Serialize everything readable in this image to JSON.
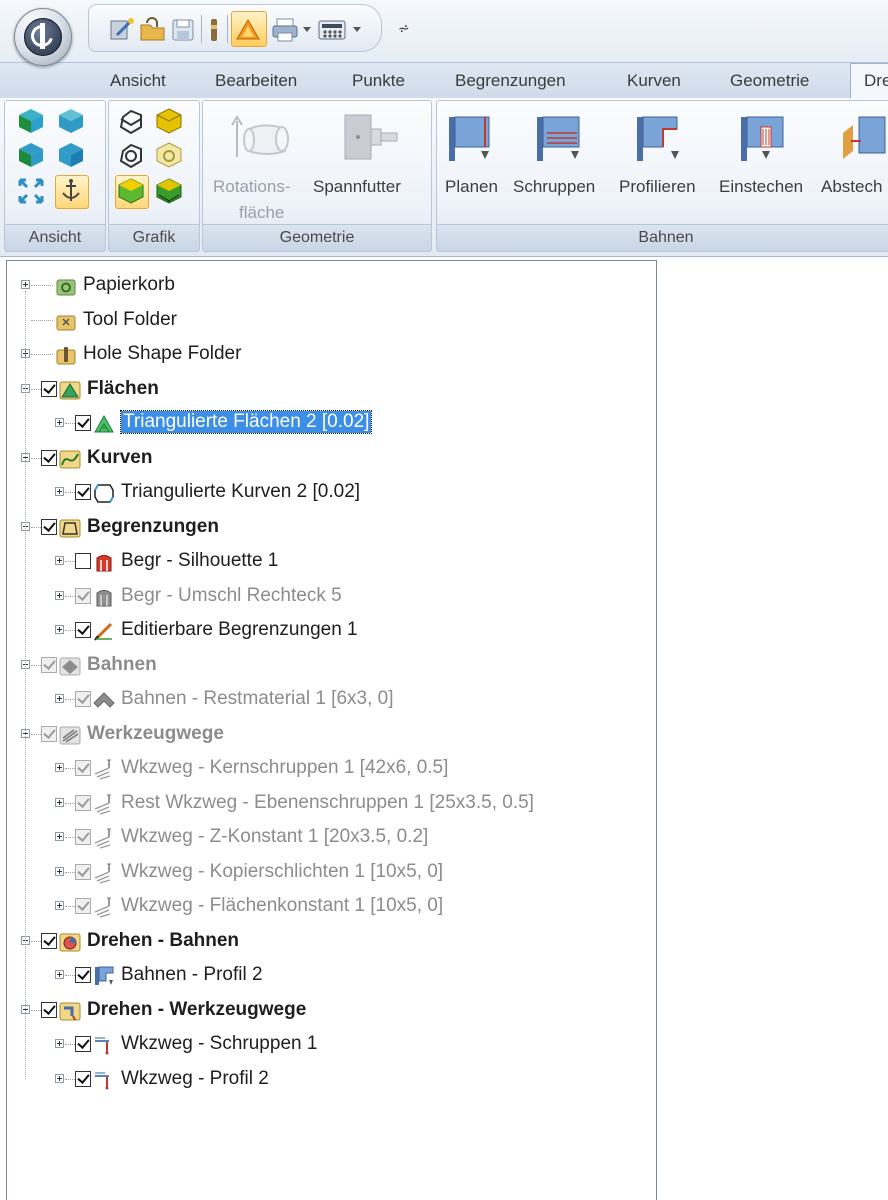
{
  "quick_access": {
    "icons": [
      "wizard-icon",
      "folder-open-icon",
      "save-icon",
      "hole-icon",
      "shading-icon",
      "print-icon",
      "calculator-icon"
    ],
    "customize_glyph": "⩫"
  },
  "tabs": [
    "Ansicht",
    "Bearbeiten",
    "Punkte",
    "Begrenzungen",
    "Kurven",
    "Geometrie",
    "Dre"
  ],
  "ribbon": {
    "groups": {
      "ansicht": "Ansicht",
      "grafik": "Grafik",
      "geometrie": "Geometrie",
      "bahnen": "Bahnen"
    },
    "geometrie_buttons": {
      "rotation_line1": "Rotations-",
      "rotation_line2": "fläche",
      "chuck": "Spannfutter"
    },
    "bahnen_buttons": {
      "planen": "Planen",
      "schruppen": "Schruppen",
      "profilieren": "Profilieren",
      "einstechen": "Einstechen",
      "abstechen": "Abstech"
    }
  },
  "tree": [
    {
      "label": "Papierkorb",
      "icon": "recycle-bin-icon",
      "level": 0,
      "expander": "plus",
      "checkbox": "none",
      "style": "normal"
    },
    {
      "label": "Tool Folder",
      "icon": "tool-folder-icon",
      "level": 0,
      "expander": "none",
      "checkbox": "none",
      "style": "normal"
    },
    {
      "label": "Hole Shape Folder",
      "icon": "hole-folder-icon",
      "level": 0,
      "expander": "plus",
      "checkbox": "none",
      "style": "normal"
    },
    {
      "label": "Flächen",
      "icon": "surfaces-icon",
      "level": 0,
      "expander": "minus",
      "checkbox": "checked",
      "style": "bold"
    },
    {
      "label": "Triangulierte Flächen 2 [0.02]",
      "icon": "triangulated-surface-icon",
      "level": 1,
      "expander": "plus",
      "checkbox": "checked",
      "style": "selected"
    },
    {
      "label": "Kurven",
      "icon": "curves-icon",
      "level": 0,
      "expander": "minus",
      "checkbox": "checked",
      "style": "bold"
    },
    {
      "label": "Triangulierte Kurven 2 [0.02]",
      "icon": "triangulated-curve-icon",
      "level": 1,
      "expander": "plus",
      "checkbox": "checked",
      "style": "normal"
    },
    {
      "label": "Begrenzungen",
      "icon": "boundaries-icon",
      "level": 0,
      "expander": "minus",
      "checkbox": "checked",
      "style": "bold"
    },
    {
      "label": "Begr - Silhouette 1",
      "icon": "silhouette-boundary-icon",
      "level": 1,
      "expander": "plus",
      "checkbox": "unchecked",
      "style": "normal"
    },
    {
      "label": "Begr - Umschl Rechteck 5",
      "icon": "rectangle-boundary-icon",
      "level": 1,
      "expander": "plus",
      "checkbox": "gray-checked",
      "style": "gray"
    },
    {
      "label": "Editierbare Begrenzungen 1",
      "icon": "editable-boundary-icon",
      "level": 1,
      "expander": "plus",
      "checkbox": "checked",
      "style": "normal"
    },
    {
      "label": "Bahnen",
      "icon": "patterns-icon",
      "level": 0,
      "expander": "minus",
      "checkbox": "gray-checked",
      "style": "bold-gray"
    },
    {
      "label": "Bahnen - Restmaterial 1 [6x3, 0]",
      "icon": "rest-pattern-icon",
      "level": 1,
      "expander": "plus",
      "checkbox": "gray-checked",
      "style": "gray"
    },
    {
      "label": "Werkzeugwege",
      "icon": "toolpaths-icon",
      "level": 0,
      "expander": "minus",
      "checkbox": "gray-checked",
      "style": "bold-gray"
    },
    {
      "label": "Wkzweg - Kernschruppen 1 [42x6, 0.5]",
      "icon": "toolpath-icon",
      "level": 1,
      "expander": "plus",
      "checkbox": "gray-checked",
      "style": "gray"
    },
    {
      "label": "Rest Wkzweg - Ebenenschruppen 1 [25x3.5, 0.5]",
      "icon": "toolpath-icon",
      "level": 1,
      "expander": "plus",
      "checkbox": "gray-checked",
      "style": "gray"
    },
    {
      "label": "Wkzweg - Z-Konstant 1 [20x3.5, 0.2]",
      "icon": "toolpath-icon",
      "level": 1,
      "expander": "plus",
      "checkbox": "gray-checked",
      "style": "gray"
    },
    {
      "label": "Wkzweg - Kopierschlichten 1 [10x5, 0]",
      "icon": "toolpath-icon",
      "level": 1,
      "expander": "plus",
      "checkbox": "gray-checked",
      "style": "gray"
    },
    {
      "label": "Wkzweg - Flächenkonstant 1 [10x5, 0]",
      "icon": "toolpath-icon",
      "level": 1,
      "expander": "plus",
      "checkbox": "gray-checked",
      "style": "gray"
    },
    {
      "label": "Drehen - Bahnen",
      "icon": "turning-patterns-icon",
      "level": 0,
      "expander": "minus",
      "checkbox": "checked",
      "style": "bold"
    },
    {
      "label": "Bahnen - Profil 2",
      "icon": "turning-profile-pattern-icon",
      "level": 1,
      "expander": "plus",
      "checkbox": "checked",
      "style": "normal"
    },
    {
      "label": "Drehen - Werkzeugwege",
      "icon": "turning-toolpaths-icon",
      "level": 0,
      "expander": "minus",
      "checkbox": "checked",
      "style": "bold"
    },
    {
      "label": "Wkzweg - Schruppen 1",
      "icon": "turning-toolpath-icon",
      "level": 1,
      "expander": "plus",
      "checkbox": "checked",
      "style": "normal"
    },
    {
      "label": "Wkzweg - Profil 2",
      "icon": "turning-toolpath-icon",
      "level": 1,
      "expander": "plus",
      "checkbox": "checked",
      "style": "normal"
    }
  ]
}
